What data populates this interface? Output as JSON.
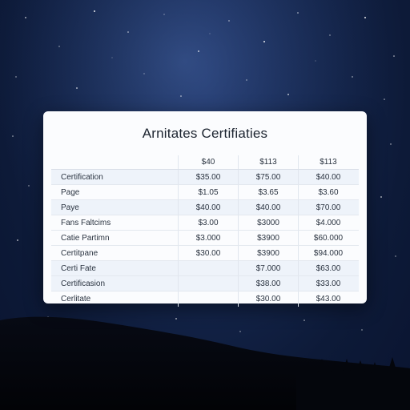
{
  "card": {
    "title": "Arnitates Certifiaties"
  },
  "table": {
    "columns": [
      "",
      "$40",
      "$113",
      "$113"
    ],
    "rows": [
      {
        "label": "Certification",
        "values": [
          "$35.00",
          "$75.00",
          "$40.00"
        ],
        "shaded": true
      },
      {
        "label": "Page",
        "values": [
          "$1.05",
          "$3.65",
          "$3.60"
        ],
        "shaded": false
      },
      {
        "label": "Paye",
        "values": [
          "$40.00",
          "$40.00",
          "$70.00"
        ],
        "shaded": true
      },
      {
        "label": "Fans Faltcims",
        "values": [
          "$3.00",
          "$3000",
          "$4.000"
        ],
        "shaded": false
      },
      {
        "label": "Catie Partimn",
        "values": [
          "$3.000",
          "$3900",
          "$60.000"
        ],
        "shaded": false
      },
      {
        "label": "Certitpane",
        "values": [
          "$30.00",
          "$3900",
          "$94.000"
        ],
        "shaded": false
      },
      {
        "label": "Certi Fate",
        "values": [
          "",
          "$7.000",
          "$63.00"
        ],
        "shaded": true
      },
      {
        "label": "Certificasion",
        "values": [
          "",
          "$38.00",
          "$33.00"
        ],
        "shaded": true
      },
      {
        "label": "Cerlitate",
        "values": [
          "",
          "$30.00",
          "$43.00"
        ],
        "shaded": false
      }
    ]
  },
  "colors": {
    "sky_top": "#1f3569",
    "sky_bottom": "#0a1430",
    "card_bg": "#fbfcfe",
    "row_shade": "#eef3fa",
    "silhouette": "#04060c"
  }
}
